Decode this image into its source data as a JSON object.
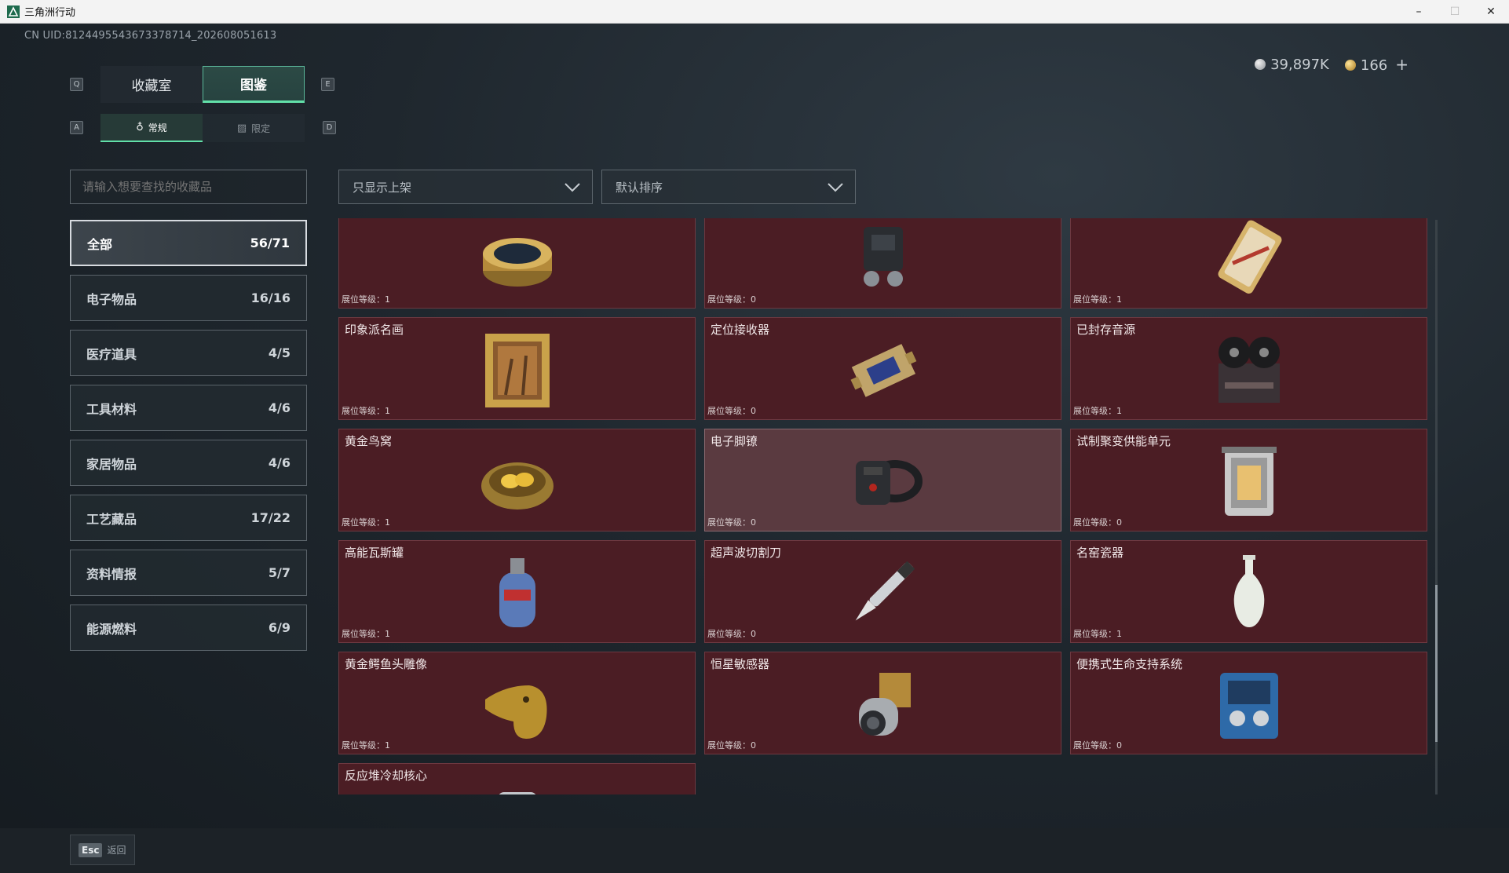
{
  "window": {
    "title": "三角洲行动",
    "minimize": "–",
    "maximize": "☐",
    "close": "✕"
  },
  "uid": "CN UID:8124495543673378714_202608051613",
  "keys": {
    "q": "Q",
    "e": "E",
    "a": "A",
    "d": "D"
  },
  "tabs": {
    "collection_room": "收藏室",
    "codex": "图鉴"
  },
  "subtabs": {
    "regular": "常规",
    "limited": "限定"
  },
  "currency": {
    "silver": "39,897K",
    "gold": "166",
    "add": "+"
  },
  "search": {
    "placeholder": "请输入想要查找的收藏品"
  },
  "filters": {
    "shelf": "只显示上架",
    "sort": "默认排序"
  },
  "categories": [
    {
      "label": "全部",
      "count": "56/71"
    },
    {
      "label": "电子物品",
      "count": "16/16"
    },
    {
      "label": "医疗道具",
      "count": "4/5"
    },
    {
      "label": "工具材料",
      "count": "4/6"
    },
    {
      "label": "家居物品",
      "count": "4/6"
    },
    {
      "label": "工艺藏品",
      "count": "17/22"
    },
    {
      "label": "资料情报",
      "count": "5/7"
    },
    {
      "label": "能源燃料",
      "count": "6/9"
    }
  ],
  "items": [
    {
      "name": "",
      "level": "展位等级：1",
      "icon": "caviar-tin-icon"
    },
    {
      "name": "",
      "level": "展位等级：0",
      "icon": "backpack-device-icon"
    },
    {
      "name": "",
      "level": "展位等级：1",
      "icon": "card-icon"
    },
    {
      "name": "印象派名画",
      "level": "展位等级：1",
      "icon": "painting-icon"
    },
    {
      "name": "定位接收器",
      "level": "展位等级：0",
      "icon": "receiver-icon"
    },
    {
      "name": "已封存音源",
      "level": "展位等级：1",
      "icon": "tape-recorder-icon"
    },
    {
      "name": "黄金鸟窝",
      "level": "展位等级：1",
      "icon": "golden-nest-icon"
    },
    {
      "name": "电子脚镣",
      "level": "展位等级：0",
      "icon": "ankle-monitor-icon"
    },
    {
      "name": "试制聚变供能单元",
      "level": "展位等级：0",
      "icon": "fusion-unit-icon"
    },
    {
      "name": "高能瓦斯罐",
      "level": "展位等级：1",
      "icon": "gas-tank-icon"
    },
    {
      "name": "超声波切割刀",
      "level": "展位等级：0",
      "icon": "ultrasonic-cutter-icon"
    },
    {
      "name": "名窑瓷器",
      "level": "展位等级：1",
      "icon": "porcelain-vase-icon"
    },
    {
      "name": "黄金鳄鱼头雕像",
      "level": "展位等级：1",
      "icon": "golden-crocodile-icon"
    },
    {
      "name": "恒星敏感器",
      "level": "展位等级：0",
      "icon": "star-sensor-icon"
    },
    {
      "name": "便携式生命支持系统",
      "level": "展位等级：0",
      "icon": "life-support-icon"
    },
    {
      "name": "反应堆冷却核心",
      "level": "",
      "icon": "reactor-core-icon"
    }
  ],
  "footer": {
    "esc_key": "Esc",
    "back": "返回"
  },
  "colors": {
    "accent": "#62e0a9",
    "card_bg": "#4b1d24",
    "card_hover": "#5a3a40"
  }
}
